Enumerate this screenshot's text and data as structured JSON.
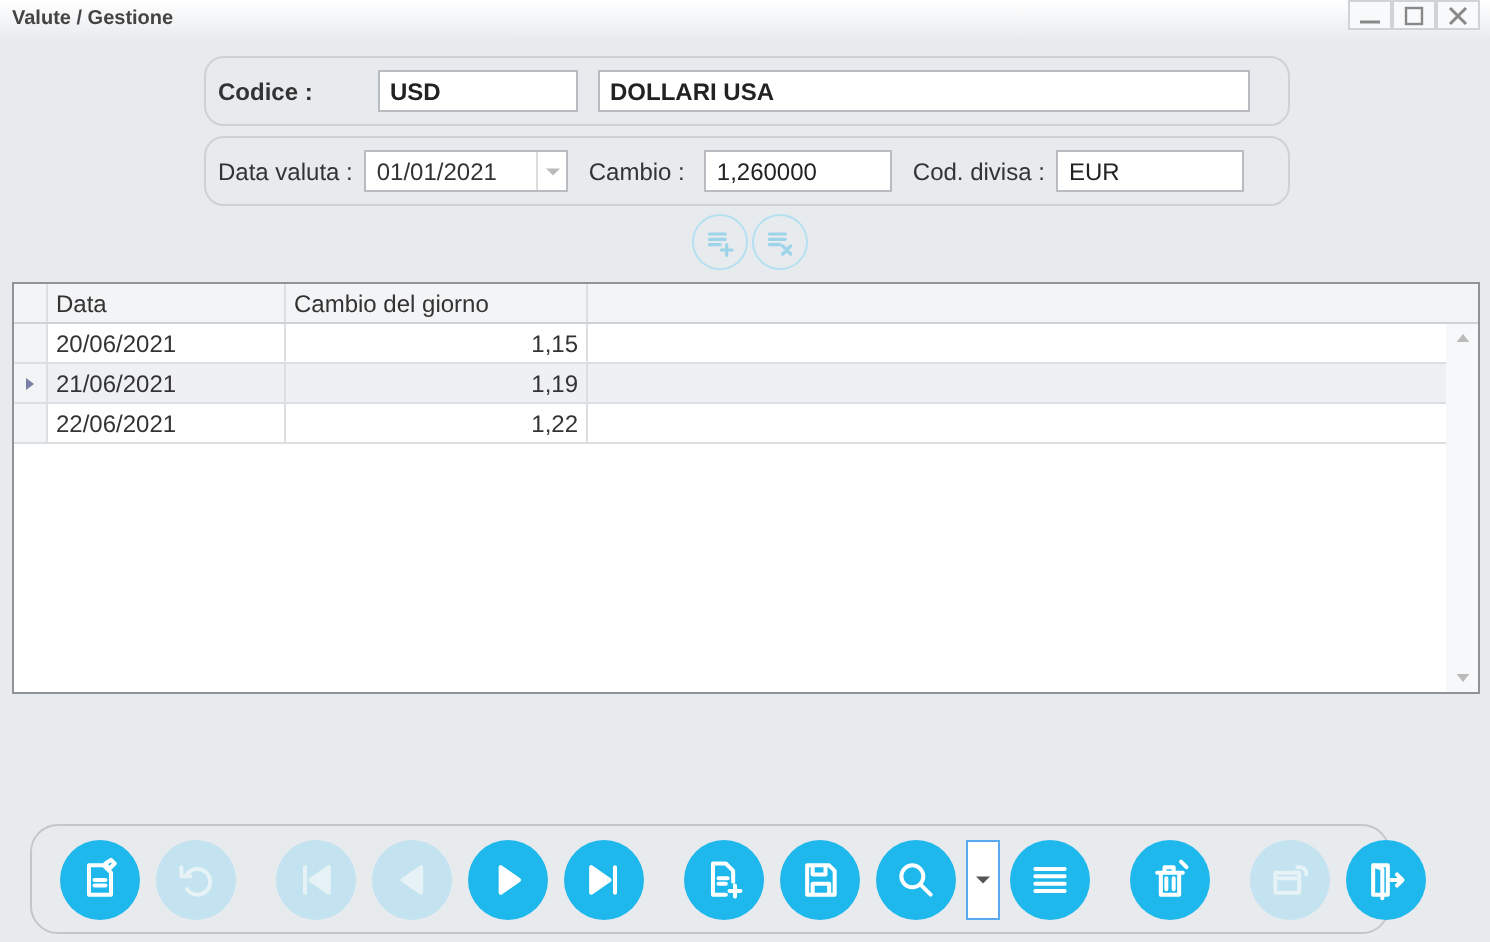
{
  "window": {
    "title": "Valute / Gestione"
  },
  "form": {
    "code_label": "Codice :",
    "code": "USD",
    "description": "DOLLARI USA",
    "date_label": "Data valuta :",
    "date": "01/01/2021",
    "rate_label": "Cambio :",
    "rate": "1,260000",
    "currency_label": "Cod. divisa :",
    "currency": "EUR"
  },
  "row_buttons": [
    {
      "kind": "add-row",
      "disabled": true
    },
    {
      "kind": "delete-row",
      "disabled": true
    }
  ],
  "table": {
    "columns": [
      "Data",
      "Cambio del giorno"
    ],
    "rows": [
      {
        "cells": [
          "20/06/2021",
          "1,15"
        ],
        "selected": false
      },
      {
        "cells": [
          "21/06/2021",
          "1,19"
        ],
        "selected": true
      },
      {
        "cells": [
          "22/06/2021",
          "1,22"
        ],
        "selected": false
      }
    ]
  },
  "toolbar": [
    [
      {
        "kind": "edit",
        "disabled": false
      },
      {
        "kind": "undo",
        "disabled": true
      }
    ],
    [
      {
        "kind": "first",
        "disabled": true
      },
      {
        "kind": "prev",
        "disabled": true
      },
      {
        "kind": "next",
        "disabled": false
      },
      {
        "kind": "last",
        "disabled": false
      }
    ],
    [
      {
        "kind": "new",
        "disabled": false
      },
      {
        "kind": "save",
        "disabled": false
      },
      {
        "kind": "search",
        "disabled": false
      },
      {
        "kind": "dropdown",
        "disabled": false
      },
      {
        "kind": "list",
        "disabled": false
      }
    ],
    [
      {
        "kind": "delete",
        "disabled": false
      }
    ],
    [
      {
        "kind": "card",
        "disabled": true
      },
      {
        "kind": "exit",
        "disabled": false
      }
    ]
  ]
}
